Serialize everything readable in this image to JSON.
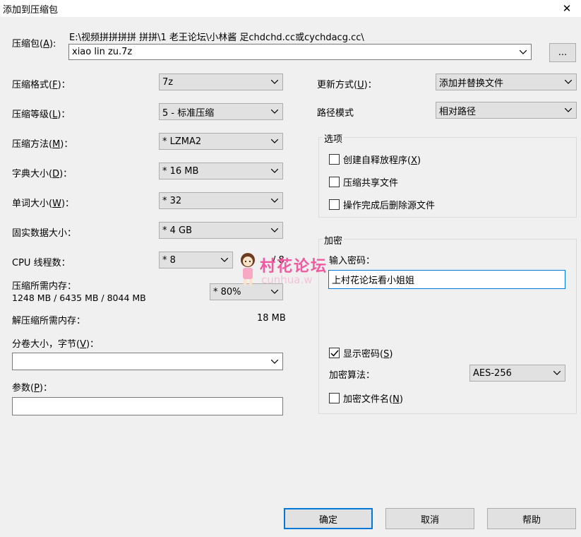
{
  "window": {
    "title": "添加到压缩包"
  },
  "archive": {
    "label_pre": "压缩包(",
    "label_key": "A",
    "label_post": "):",
    "path": "E:\\视频拼拼拼拼 拼拼\\1 老王论坛\\小林酱 足chdchd.cc或cychdacg.cc\\",
    "name": "xiao lin zu.7z",
    "browse_label": "..."
  },
  "left": {
    "format": {
      "label_pre": "压缩格式(",
      "key": "F",
      "label_post": ")：",
      "value": "7z"
    },
    "level": {
      "label_pre": "压缩等级(",
      "key": "L",
      "label_post": ")：",
      "value": "5 - 标准压缩"
    },
    "method": {
      "label_pre": "压缩方法(",
      "key": "M",
      "label_post": ")：",
      "value": "* LZMA2"
    },
    "dict": {
      "label_pre": "字典大小(",
      "key": "D",
      "label_post": ")：",
      "value": "* 16 MB"
    },
    "word": {
      "label_pre": "单词大小(",
      "key": "W",
      "label_post": ")：",
      "value": "* 32"
    },
    "solid": {
      "label": "固实数据大小：",
      "value": "* 4 GB"
    },
    "threads": {
      "label": "CPU 线程数：",
      "value": "* 8",
      "max": "/ 8"
    },
    "mem_compress": {
      "label": "压缩所需内存：",
      "value": "1248 MB / 6435 MB / 8044 MB",
      "percent": "* 80%"
    },
    "mem_decompress": {
      "label": "解压缩所需内存：",
      "value": "18 MB"
    },
    "volume": {
      "label_pre": "分卷大小，字节(",
      "key": "V",
      "label_post": ")：",
      "value": ""
    },
    "params": {
      "label_pre": "参数(",
      "key": "P",
      "label_post": ")：",
      "value": ""
    }
  },
  "right": {
    "update": {
      "label_pre": "更新方式(",
      "key": "U",
      "label_post": ")：",
      "value": "添加并替换文件"
    },
    "pathmode": {
      "label": "路径模式",
      "value": "相对路径"
    },
    "options": {
      "title": "选项",
      "sfx": {
        "label_pre": "创建自释放程序(",
        "key": "X",
        "label_post": ")",
        "checked": false
      },
      "shared": {
        "label": "压缩共享文件",
        "checked": false
      },
      "delete": {
        "label": "操作完成后删除源文件",
        "checked": false
      }
    },
    "encryption": {
      "title": "加密",
      "password_label": "输入密码：",
      "password_value": "上村花论坛看小姐姐",
      "show_pre": "显示密码(",
      "show_key": "S",
      "show_post": ")",
      "show_checked": true,
      "algo_label": "加密算法：",
      "algo_value": "AES-256",
      "encrypt_names_pre": "加密文件名(",
      "encrypt_names_key": "N",
      "encrypt_names_post": ")",
      "encrypt_names_checked": false
    }
  },
  "buttons": {
    "ok": "确定",
    "cancel": "取消",
    "help": "帮助"
  },
  "watermark": {
    "text": "村花论坛",
    "sub": "cunhua.w"
  },
  "colors": {
    "accent": "#0078d7",
    "watermark_pink": "#f25aa0"
  }
}
